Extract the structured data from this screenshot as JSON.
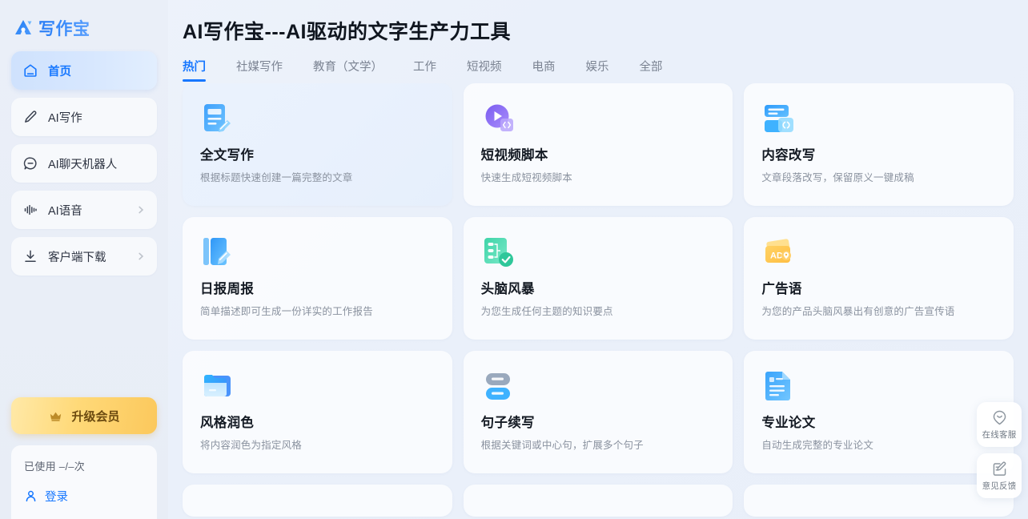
{
  "brand": {
    "name": "写作宝",
    "logo_icon": "logo-mark-icon",
    "accent": "#1677ff"
  },
  "sidebar": {
    "items": [
      {
        "label": "首页",
        "icon": "home-icon",
        "active": true,
        "chevron": false
      },
      {
        "label": "AI写作",
        "icon": "pencil-icon",
        "active": false,
        "chevron": false
      },
      {
        "label": "AI聊天机器人",
        "icon": "chat-bubble-icon",
        "active": false,
        "chevron": false
      },
      {
        "label": "AI语音",
        "icon": "waveform-icon",
        "active": false,
        "chevron": true
      },
      {
        "label": "客户端下载",
        "icon": "download-icon",
        "active": false,
        "chevron": true
      }
    ],
    "upgrade": {
      "label": "升级会员",
      "icon": "crown-icon",
      "color": "#ffd978"
    },
    "user": {
      "usage_text": "已使用 –/–次",
      "login_label": "登录",
      "login_icon": "user-icon"
    }
  },
  "header": {
    "title": "AI写作宝---AI驱动的文字生产力工具"
  },
  "tabs": [
    {
      "label": "热门",
      "active": true
    },
    {
      "label": "社媒写作",
      "active": false
    },
    {
      "label": "教育（文学）",
      "active": false
    },
    {
      "label": "工作",
      "active": false
    },
    {
      "label": "短视频",
      "active": false
    },
    {
      "label": "电商",
      "active": false
    },
    {
      "label": "娱乐",
      "active": false
    },
    {
      "label": "全部",
      "active": false
    }
  ],
  "cards": [
    {
      "title": "全文写作",
      "desc": "根据标题快速创建一篇完整的文章",
      "icon": "document-pencil-icon",
      "hovered": true
    },
    {
      "title": "短视频脚本",
      "desc": "快速生成短视频脚本",
      "icon": "play-code-icon",
      "hovered": false
    },
    {
      "title": "内容改写",
      "desc": "文章段落改写，保留原义一键成稿",
      "icon": "rewrite-braces-icon",
      "hovered": false
    },
    {
      "title": "日报周报",
      "desc": "简单描述即可生成一份详实的工作报告",
      "icon": "report-book-icon",
      "hovered": false
    },
    {
      "title": "头脑风暴",
      "desc": "为您生成任何主题的知识要点",
      "icon": "mindmap-check-icon",
      "hovered": false
    },
    {
      "title": "广告语",
      "desc": "为您的产品头脑风暴出有创意的广告宣传语",
      "icon": "ad-card-icon",
      "hovered": false
    },
    {
      "title": "风格润色",
      "desc": "将内容润色为指定风格",
      "icon": "folder-stack-icon",
      "hovered": false
    },
    {
      "title": "句子续写",
      "desc": "根据关键词或中心句，扩展多个句子",
      "icon": "two-bars-icon",
      "hovered": false
    },
    {
      "title": "专业论文",
      "desc": "自动生成完整的专业论文",
      "icon": "paper-doc-icon",
      "hovered": false
    }
  ],
  "float_buttons": [
    {
      "label": "在线客服",
      "icon": "smile-support-icon"
    },
    {
      "label": "意见反馈",
      "icon": "feedback-edit-icon"
    }
  ]
}
